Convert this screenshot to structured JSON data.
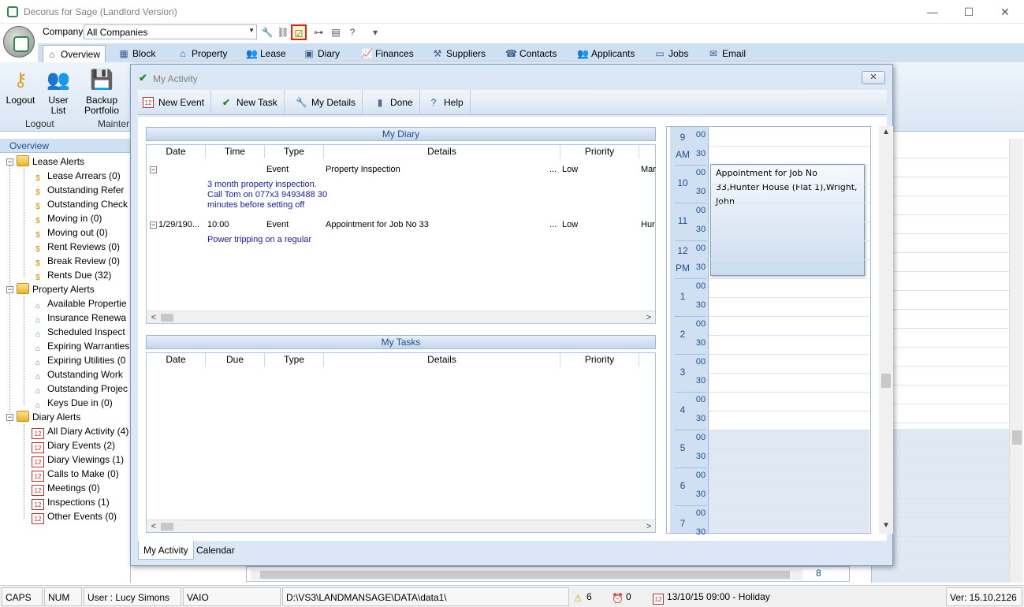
{
  "window": {
    "title": "Decorus for Sage (Landlord Version)",
    "minimize": "—",
    "maximize": "☐",
    "close": "✕"
  },
  "ribbon_top": {
    "company_label": "Company",
    "company_value": "All Companies",
    "qat_icons": [
      "wrench-icon",
      "link-icon",
      "activity-icon",
      "tree-icon",
      "document-icon",
      "help-icon",
      "dropdown-icon"
    ]
  },
  "tabs": [
    {
      "label": "Overview",
      "icon": "house-icon",
      "active": true
    },
    {
      "label": "Block",
      "icon": "grid-icon"
    },
    {
      "label": "Property",
      "icon": "house-icon"
    },
    {
      "label": "Lease",
      "icon": "people-icon"
    },
    {
      "label": "Diary",
      "icon": "calendar-icon"
    },
    {
      "label": "Finances",
      "icon": "chart-icon"
    },
    {
      "label": "Suppliers",
      "icon": "tools-icon"
    },
    {
      "label": "Contacts",
      "icon": "contacts-icon"
    },
    {
      "label": "Applicants",
      "icon": "people-icon"
    },
    {
      "label": "Jobs",
      "icon": "clipboard-icon"
    },
    {
      "label": "Email",
      "icon": "email-icon"
    }
  ],
  "ribbon": {
    "logout_line1": "Logout",
    "userlist_line1": "User",
    "userlist_line2": "List",
    "backup_line1": "Backup",
    "backup_line2": "Portfolio",
    "group_logout": "Logout",
    "group_maint": "Mainter"
  },
  "tree": {
    "header": "Overview",
    "lease_alerts": "Lease Alerts",
    "lease_items": [
      "Lease Arrears (0)",
      "Outstanding Refer",
      "Outstanding Check",
      "Moving in (0)",
      "Moving out (0)",
      "Rent Reviews (0)",
      "Break Review (0)",
      "Rents Due (32)"
    ],
    "property_alerts": "Property Alerts",
    "property_items": [
      "Available Propertie",
      "Insurance Renewa",
      "Scheduled Inspect",
      "Expiring Warranties",
      "Expiring Utilities (0",
      "Outstanding Work",
      "Outstanding Projec",
      "Keys Due in (0)"
    ],
    "diary_alerts": "Diary Alerts",
    "diary_items": [
      "All Diary Activity (4)",
      "Diary Events (2)",
      "Diary Viewings (1)",
      "Calls to Make (0)",
      "Meetings (0)",
      "Inspections (1)",
      "Other Events (0)"
    ]
  },
  "dialog": {
    "title": "My Activity",
    "toolbar": {
      "new_event": "New Event",
      "new_task": "New Task",
      "my_details": "My Details",
      "done": "Done",
      "help": "Help"
    },
    "diary": {
      "title": "My Diary",
      "columns": [
        "Date",
        "Time",
        "Type",
        "Details",
        "Priority"
      ],
      "rows": [
        {
          "date": "",
          "time": "",
          "type": "Event",
          "details": "Property Inspection",
          "ellipsis": "...",
          "priority": "Low",
          "extra": "Mar",
          "notes": [
            "3 month property inspection.",
            "Call Tom on 077x3 9493488 30",
            "minutes before setting off"
          ]
        },
        {
          "date": "1/29/190...",
          "time": "10:00",
          "type": "Event",
          "details": "Appointment for Job No 33",
          "ellipsis": "...",
          "priority": "Low",
          "extra": "Hur",
          "notes": [
            "Power tripping on a regular"
          ]
        }
      ]
    },
    "tasks": {
      "title": "My Tasks",
      "columns": [
        "Date",
        "Due",
        "Type",
        "Details",
        "Priority"
      ]
    },
    "calendar": {
      "hours": [
        {
          "h": "9",
          "sub": "AM"
        },
        {
          "h": "10",
          "sub": ""
        },
        {
          "h": "11",
          "sub": ""
        },
        {
          "h": "12",
          "sub": "PM"
        },
        {
          "h": "1",
          "sub": ""
        },
        {
          "h": "2",
          "sub": ""
        },
        {
          "h": "3",
          "sub": ""
        },
        {
          "h": "4",
          "sub": ""
        },
        {
          "h": "5",
          "sub": ""
        },
        {
          "h": "6",
          "sub": ""
        },
        {
          "h": "7",
          "sub": ""
        }
      ],
      "min_00": "00",
      "min_30": "30",
      "appointment": "Appointment for Job No 33,Hunter House (Flat 1),Wright, John"
    },
    "bottom_tabs": [
      {
        "label": "My Activity",
        "active": true
      },
      {
        "label": "Calendar"
      }
    ]
  },
  "background": {
    "bottom_number": "8",
    "bottom_min": "30"
  },
  "status": {
    "caps": "CAPS",
    "num": "NUM",
    "user": "User : Lucy Simons",
    "machine": "VAIO",
    "path": "D:\\VS3\\LANDMANSAGE\\DATA\\data1\\",
    "alerts_count": "6",
    "clock_count": "0",
    "holiday": "13/10/15 09:00 - Holiday",
    "version": "Ver: 15.10.2126"
  }
}
